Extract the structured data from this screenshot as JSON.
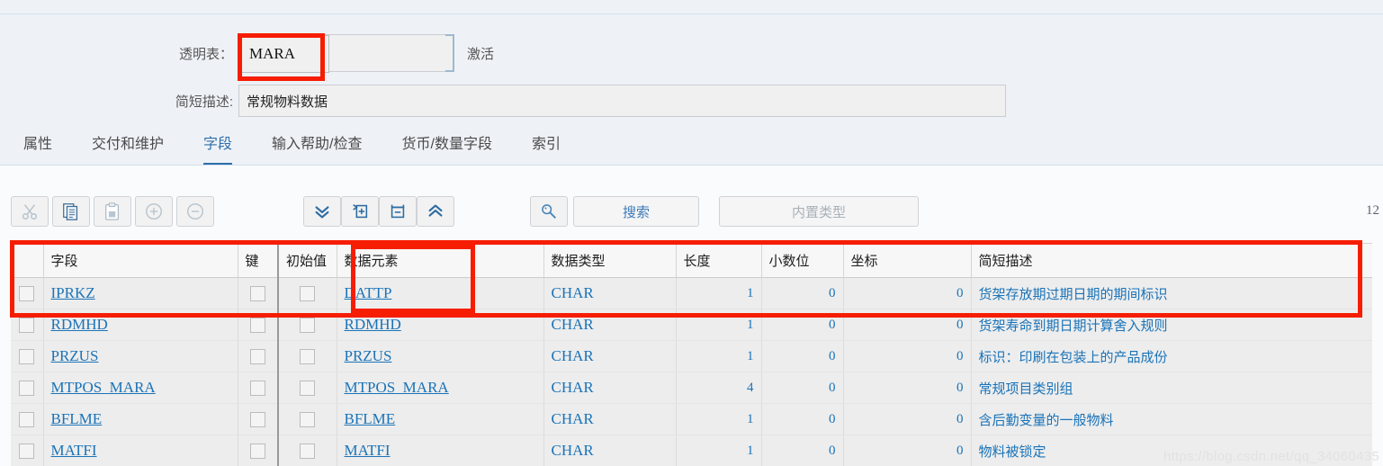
{
  "form": {
    "table_label": "透明表：",
    "table_value": "MARA",
    "activate_label": "激活",
    "desc_label": "简短描述:",
    "desc_value": "常规物料数据"
  },
  "tabs": [
    {
      "label": "属性",
      "active": false
    },
    {
      "label": "交付和维护",
      "active": false
    },
    {
      "label": "字段",
      "active": true
    },
    {
      "label": "输入帮助/检查",
      "active": false
    },
    {
      "label": "货币/数量字段",
      "active": false
    },
    {
      "label": "索引",
      "active": false
    }
  ],
  "toolbar": {
    "buttons": [
      {
        "name": "cut-icon",
        "title": "剪切",
        "disabled": true
      },
      {
        "name": "copy-icon",
        "title": "复制",
        "disabled": false
      },
      {
        "name": "paste-icon",
        "title": "粘贴",
        "disabled": true
      },
      {
        "name": "add-row-icon",
        "title": "添加",
        "disabled": true
      },
      {
        "name": "remove-row-icon",
        "title": "删除",
        "disabled": true
      },
      {
        "name": "chevron-double-down-icon",
        "title": "向下",
        "disabled": false
      },
      {
        "name": "insert-row-icon",
        "title": "插入行",
        "disabled": false
      },
      {
        "name": "delete-row-icon",
        "title": "删除行",
        "disabled": false
      },
      {
        "name": "chevron-double-up-icon",
        "title": "向上",
        "disabled": false
      }
    ],
    "search_icon": "magnifier-icon",
    "search_label": "搜索",
    "builtin_type_label": "内置类型",
    "row_count": "12"
  },
  "table": {
    "columns": [
      "字段",
      "键",
      "初始值",
      "数据元素",
      "数据类型",
      "长度",
      "小数位",
      "坐标",
      "简短描述"
    ],
    "rows": [
      {
        "field": "IPRKZ",
        "key": false,
        "initial": false,
        "data_element": "DATTP",
        "data_type": "CHAR",
        "length": "1",
        "decimals": "0",
        "coord": "0",
        "desc": "货架存放期过期日期的期间标识"
      },
      {
        "field": "RDMHD",
        "key": false,
        "initial": false,
        "data_element": "RDMHD",
        "data_type": "CHAR",
        "length": "1",
        "decimals": "0",
        "coord": "0",
        "desc": "货架寿命到期日期计算舍入规则"
      },
      {
        "field": "PRZUS",
        "key": false,
        "initial": false,
        "data_element": "PRZUS",
        "data_type": "CHAR",
        "length": "1",
        "decimals": "0",
        "coord": "0",
        "desc": "标识：印刷在包装上的产品成份"
      },
      {
        "field": "MTPOS_MARA",
        "key": false,
        "initial": false,
        "data_element": "MTPOS_MARA",
        "data_type": "CHAR",
        "length": "4",
        "decimals": "0",
        "coord": "0",
        "desc": "常规项目类别组"
      },
      {
        "field": "BFLME",
        "key": false,
        "initial": false,
        "data_element": "BFLME",
        "data_type": "CHAR",
        "length": "1",
        "decimals": "0",
        "coord": "0",
        "desc": "含后勤变量的一般物料"
      },
      {
        "field": "MATFI",
        "key": false,
        "initial": false,
        "data_element": "MATFI",
        "data_type": "CHAR",
        "length": "1",
        "decimals": "0",
        "coord": "0",
        "desc": "物料被锁定"
      }
    ]
  },
  "watermark": "https://blog.csdn.net/qq_34060435",
  "colors": {
    "page_bg": "#eef2f7",
    "content_bg": "#fafbfc",
    "accent_blue": "#2f6fa8",
    "link_blue": "#1a73b8",
    "annotation_red": "#f61d02",
    "row_bg": "#ededed",
    "header_bg": "#f7f7f7"
  }
}
